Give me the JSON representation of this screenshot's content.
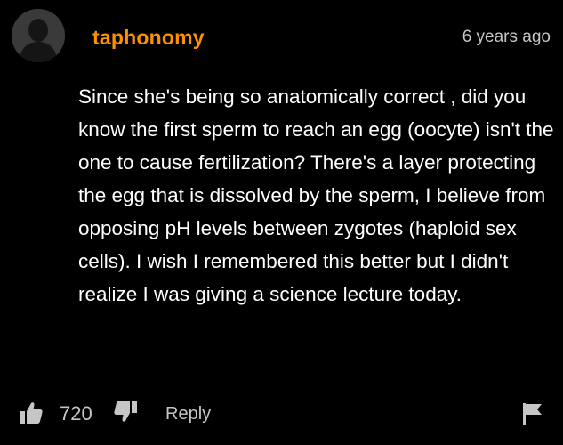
{
  "comment": {
    "username": "taphonomy",
    "timestamp": "6 years ago",
    "text": "Since she's being so anatomically correct , did you know the first sperm to reach an egg (oocyte) isn't the one to cause fertilization? There's a layer protecting the egg that is dissolved by the sperm, I believe from opposing pH levels between zygotes (haploid sex cells). I wish I remembered this better but I didn't realize I was giving a science lecture today.",
    "likes": "720",
    "reply_label": "Reply"
  },
  "icons": {
    "avatar": "default-avatar-silhouette",
    "like": "thumbs-up-icon",
    "dislike": "thumbs-down-icon",
    "flag": "flag-icon"
  },
  "colors": {
    "background": "#000000",
    "username": "#ff9000",
    "text": "#ffffff",
    "muted": "#c6c6c6"
  }
}
